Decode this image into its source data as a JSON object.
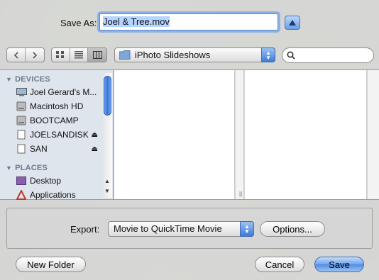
{
  "save_as": {
    "label": "Save As:",
    "value": "Joel & Tree.mov"
  },
  "toolbar": {
    "back_icon": "chevron-left-icon",
    "forward_icon": "chevron-right-icon",
    "views": [
      "icon-view-icon",
      "list-view-icon",
      "column-view-icon"
    ],
    "active_view": "column-view-icon",
    "location": "iPhoto Slideshows",
    "search_placeholder": ""
  },
  "sidebar": {
    "devices_header": "DEVICES",
    "devices": [
      {
        "label": "Joel Gerard's M...",
        "icon": "computer-icon",
        "eject": false
      },
      {
        "label": "Macintosh HD",
        "icon": "hard-disk-icon",
        "eject": false
      },
      {
        "label": "BOOTCAMP",
        "icon": "hard-disk-icon",
        "eject": false
      },
      {
        "label": "JOELSANDISK",
        "icon": "removable-disk-icon",
        "eject": true
      },
      {
        "label": "SAN",
        "icon": "removable-disk-icon",
        "eject": true
      }
    ],
    "places_header": "PLACES",
    "places": [
      {
        "label": "Desktop",
        "icon": "desktop-icon"
      },
      {
        "label": "Applications",
        "icon": "applications-icon"
      }
    ]
  },
  "export": {
    "label": "Export:",
    "selected": "Movie to QuickTime Movie",
    "options_label": "Options..."
  },
  "footer": {
    "new_folder_label": "New Folder",
    "cancel_label": "Cancel",
    "save_label": "Save"
  },
  "colors": {
    "accent": "#4f8be3",
    "sidebar_bg": "#dfe5ed",
    "header_text": "#6c7a8c"
  }
}
